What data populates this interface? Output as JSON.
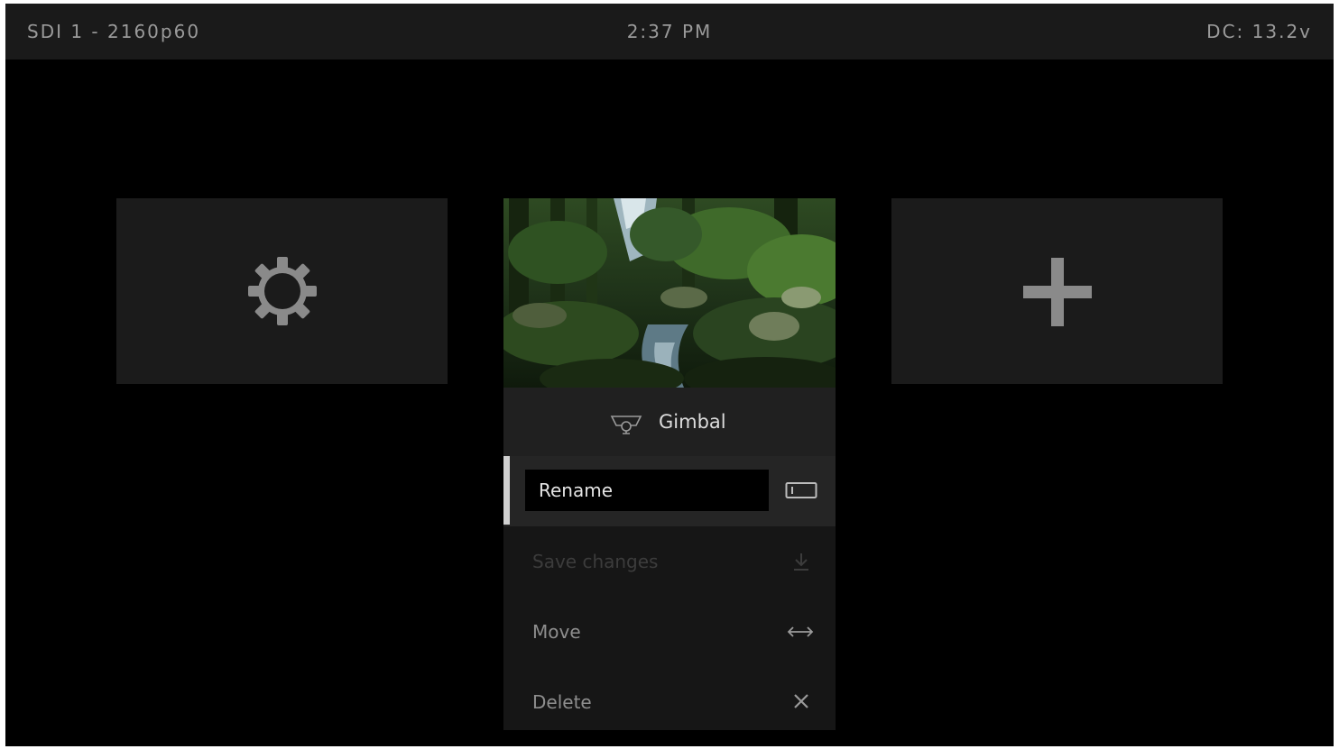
{
  "status_bar": {
    "input": "SDI 1 - 2160p60",
    "clock": "2:37 PM",
    "power": "DC: 13.2v"
  },
  "tiles": {
    "settings_icon": "gear-icon",
    "add_icon": "plus-icon"
  },
  "preset": {
    "icon": "gimbal-icon",
    "name": "Gimbal"
  },
  "menu": {
    "rename": {
      "label": "Rename",
      "icon": "rename-field-icon"
    },
    "save": {
      "label": "Save changes",
      "icon": "save-download-icon",
      "disabled": true
    },
    "move": {
      "label": "Move",
      "icon": "move-arrows-icon"
    },
    "delete": {
      "label": "Delete",
      "icon": "close-icon"
    }
  },
  "colors": {
    "background": "#000000",
    "status_bar": "#1a1a1a",
    "tile": "#1b1b1b",
    "icon_gray": "#8a8a8a",
    "selection_accent": "#d0d0d0"
  }
}
